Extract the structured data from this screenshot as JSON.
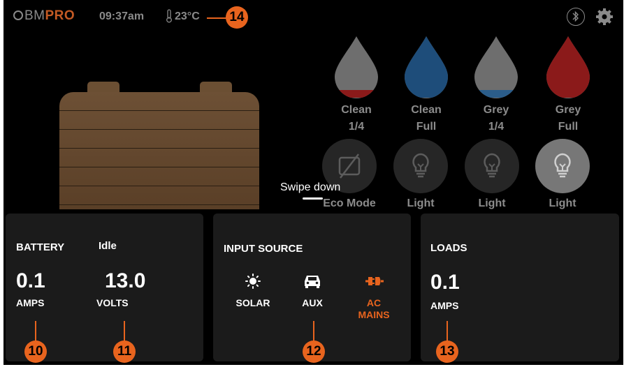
{
  "status_bar": {
    "logo_prefix": "BM",
    "logo_suffix": "PRO",
    "time": "09:37am",
    "temperature": "23°C",
    "bluetooth_icon": "bluetooth-icon",
    "settings_icon": "gear-icon"
  },
  "tanks": [
    {
      "name": "Clean",
      "level": "1/4",
      "color": "#8b1a1a",
      "fill": 0.12
    },
    {
      "name": "Clean",
      "level": "Full",
      "color": "#1e4d7a",
      "fill": 1.0
    },
    {
      "name": "Grey",
      "level": "1/4",
      "color": "#2b5d8a",
      "fill": 0.12
    },
    {
      "name": "Grey",
      "level": "Full",
      "color": "#8b1a1a",
      "fill": 1.0
    }
  ],
  "controls": [
    {
      "label": "Eco Mode",
      "icon": "eco-mode-icon",
      "on": false
    },
    {
      "label": "Light",
      "icon": "lightbulb-icon",
      "on": false
    },
    {
      "label": "Light",
      "icon": "lightbulb-icon",
      "on": false
    },
    {
      "label": "Light",
      "icon": "lightbulb-icon",
      "on": true
    }
  ],
  "swipe_hint": "Swipe down",
  "battery_panel": {
    "title": "BATTERY",
    "state": "Idle",
    "amps_value": "0.1",
    "amps_unit": "AMPS",
    "volts_value": "13.0",
    "volts_unit": "VOLTS"
  },
  "input_panel": {
    "title": "INPUT SOURCE",
    "sources": [
      {
        "label": "SOLAR",
        "icon": "sun-icon",
        "active": false
      },
      {
        "label": "AUX",
        "icon": "car-icon",
        "active": false
      },
      {
        "label_line1": "AC",
        "label_line2": "MAINS",
        "icon": "plug-icon",
        "active": true
      }
    ]
  },
  "loads_panel": {
    "title": "LOADS",
    "amps_value": "0.1",
    "amps_unit": "AMPS"
  },
  "callouts": [
    "10",
    "11",
    "12",
    "13",
    "14"
  ],
  "colors": {
    "accent": "#e8641e",
    "battery": "#6b4f33",
    "panel": "#1b1b1b"
  }
}
